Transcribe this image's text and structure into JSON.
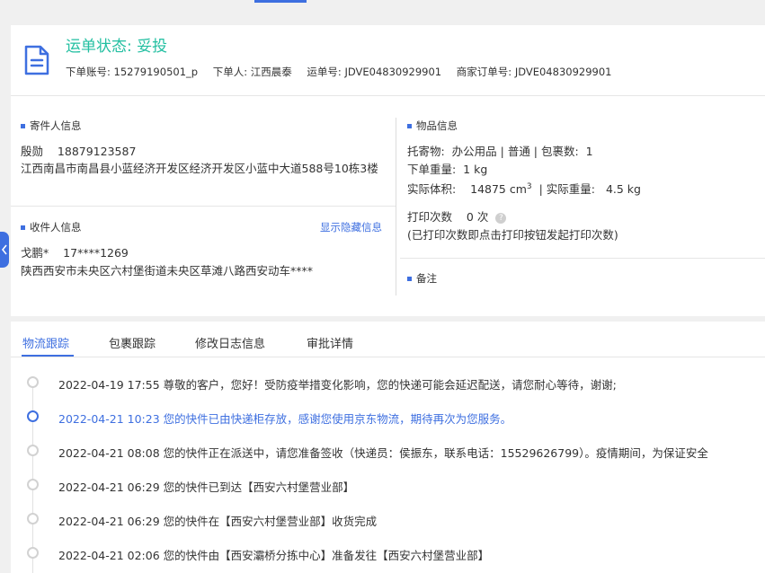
{
  "header": {
    "status_label": "运单状态:",
    "status_value": "妥投",
    "meta": [
      {
        "label": "下单账号:",
        "value": "15279190501_p"
      },
      {
        "label": "下单人:",
        "value": "江西晨泰"
      },
      {
        "label": "运单号:",
        "value": "JDVE04830929901"
      },
      {
        "label": "商家订单号:",
        "value": "JDVE04830929901"
      }
    ]
  },
  "sender": {
    "title": "寄件人信息",
    "name": "殷勋",
    "phone": "18879123587",
    "address": "江西南昌市南昌县小蓝经济开发区经济开发区小蓝中大道588号10栋3楼"
  },
  "receiver": {
    "title": "收件人信息",
    "show_hidden_link": "显示隐藏信息",
    "name": "戈鹏*",
    "phone": "17****1269",
    "address": "陕西西安市未央区六村堡街道未央区草滩八路西安动车****"
  },
  "goods": {
    "title": "物品信息",
    "item_label": "托寄物:",
    "item_value": "办公用品 | 普通 | 包裹数:",
    "package_count": "1",
    "weight_label": "下单重量:",
    "weight_value": "1 kg",
    "volume_label": "实际体积:",
    "volume_value": "14875 cm",
    "volume_sup": "3",
    "actual_weight_label": "| 实际重量:",
    "actual_weight_value": "4.5 kg",
    "print_label": "打印次数",
    "print_value": "0 次",
    "print_note": "(已打印次数即点击打印按钮发起打印次数)"
  },
  "remark": {
    "title": "备注"
  },
  "tabs": [
    {
      "label": "物流跟踪"
    },
    {
      "label": "包裹跟踪"
    },
    {
      "label": "修改日志信息"
    },
    {
      "label": "审批详情"
    }
  ],
  "timeline": [
    {
      "time": "2022-04-19 17:55",
      "text": "尊敬的客户，您好！受防疫举措变化影响，您的快递可能会延迟配送，请您耐心等待，谢谢;"
    },
    {
      "time": "2022-04-21 10:23",
      "text": "您的快件已由快递柜存放，感谢您使用京东物流，期待再次为您服务。"
    },
    {
      "time": "2022-04-21 08:08",
      "text": "您的快件正在派送中，请您准备签收（快递员：侯振东，联系电话：15529626799）。疫情期间，为保证安全"
    },
    {
      "time": "2022-04-21 06:29",
      "text": "您的快件已到达【西安六村堡营业部】"
    },
    {
      "time": "2022-04-21 06:29",
      "text": "您的快件在【西安六村堡营业部】收货完成"
    },
    {
      "time": "2022-04-21 02:06",
      "text": "您的快件由【西安灞桥分拣中心】准备发往【西安六村堡营业部】"
    }
  ],
  "colors": {
    "accent": "#3e6fe0",
    "status": "#22bfa1"
  }
}
